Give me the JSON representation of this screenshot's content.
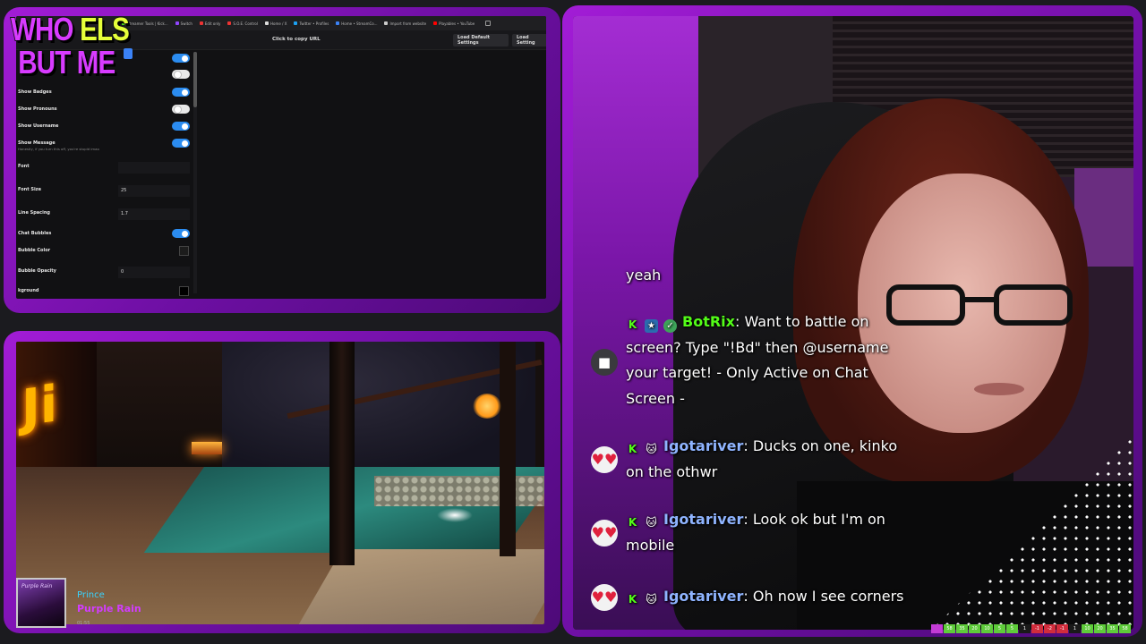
{
  "logo": {
    "line1_a": "WHO",
    "line1_b": "ELS",
    "line2": "BUT ME"
  },
  "colors": {
    "frame": "#8a16c4",
    "kick_green": "#53fc18",
    "username_blue": "#8fb4ff",
    "toggle_on": "#2b8cf0"
  },
  "browser": {
    "tabs": [
      {
        "label": "Streamer Tools | Kick...",
        "icon": "kick-icon",
        "color": "#53fc18"
      },
      {
        "label": "Switch",
        "icon": "twitch-icon",
        "color": "#9146ff"
      },
      {
        "label": "Edit only",
        "icon": "doc-icon",
        "color": "#e33"
      },
      {
        "label": "S.O.E. Control",
        "icon": "app-icon",
        "color": "#e33"
      },
      {
        "label": "Home / X",
        "icon": "x-icon",
        "color": "#ddd"
      },
      {
        "label": "Twitter • Profiles",
        "icon": "bird-icon",
        "color": "#1da1f2"
      },
      {
        "label": "Home • StreamCo...",
        "icon": "app-icon",
        "color": "#3b82f6"
      },
      {
        "label": "Import from website",
        "icon": "globe-icon",
        "color": "#ccc"
      },
      {
        "label": "Playables • YouTube",
        "icon": "youtube-icon",
        "color": "#f00"
      }
    ],
    "copy_url": "Click to copy URL",
    "load_default": "Load Default Settings",
    "load_settings": "Load Setting"
  },
  "settings": {
    "show_badges": "Show Badges",
    "show_pronouns": "Show Pronouns",
    "show_username": "Show Username",
    "show_message": "Show Message",
    "show_message_sub": "Honestly, if you turn this off, you're stupid imao",
    "font": "Font",
    "font_size": "Font Size",
    "font_size_value": "25",
    "line_spacing": "Line Spacing",
    "line_spacing_value": "1.7",
    "chat_bubbles": "Chat Bubbles",
    "bubble_color": "Bubble Color",
    "bubble_opacity": "Bubble Opacity",
    "bubble_opacity_value": "0",
    "background": "kground",
    "toggles": {
      "top1": true,
      "top2": false,
      "badges": true,
      "pronouns": false,
      "username": true,
      "message": true,
      "bubbles": true
    }
  },
  "now_playing": {
    "album_text": "Purple Rain",
    "artist": "Prince",
    "title": "Purple Rain",
    "time": "01:55"
  },
  "chat": {
    "messages": [
      {
        "avatar": "",
        "text": "yeah"
      },
      {
        "avatar": "bot-avatar",
        "username": "BotRix",
        "text": ": Want to battle on screen? Type \"!Bd\" then @username your target! - Only Active on Chat Screen -"
      },
      {
        "avatar": "heart-eyes-avatar",
        "username": "Igotariver",
        "text": ": Ducks on one, kinko on the othwr"
      },
      {
        "avatar": "heart-eyes-avatar",
        "username": "Igotariver",
        "text": ": Look ok but I'm on mobile"
      },
      {
        "avatar": "heart-eyes-avatar",
        "username": "Igotariver",
        "text": ": Oh now I see corners"
      }
    ]
  },
  "counter": [
    "58",
    "35",
    "20",
    "10",
    "5",
    "5",
    "1",
    "-1",
    "-2",
    "-1",
    "1",
    "10",
    "20",
    "35",
    "58"
  ]
}
